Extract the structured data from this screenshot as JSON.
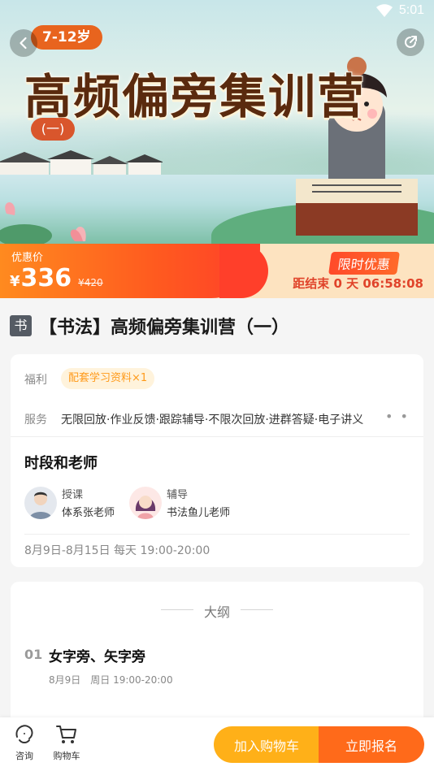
{
  "status_bar": {
    "time": "5:01"
  },
  "hero": {
    "age_tag": "7-12岁",
    "title": "高频偏旁集训营",
    "sub_tag": "(一)"
  },
  "price": {
    "label": "优惠价",
    "currency": "¥",
    "value": "336",
    "original": "¥420",
    "limited_tag": "限时优惠",
    "countdown": "距结束 0 天 06:58:08"
  },
  "course": {
    "badge": "书",
    "title": "【书法】高频偏旁集训营（一）"
  },
  "info": {
    "benefit_label": "福利",
    "benefit_pill": "配套学习资料×1",
    "service_label": "服务",
    "service_text": "无限回放·作业反馈·跟踪辅导·不限次回放·进群答疑·电子讲义",
    "section_title": "时段和老师",
    "teachers": [
      {
        "role": "授课",
        "name": "体系张老师"
      },
      {
        "role": "辅导",
        "name": "书法鱼儿老师"
      }
    ],
    "schedule": "8月9日-8月15日 每天 19:00-20:00"
  },
  "outline": {
    "heading": "大纲",
    "lessons": [
      {
        "num": "01",
        "title": "女字旁、矢字旁",
        "time": "8月9日　周日 19:00-20:00"
      }
    ]
  },
  "bottom_bar": {
    "consult_label": "咨询",
    "cart_label": "购物车",
    "add_cart": "加入购物车",
    "signup": "立即报名"
  },
  "colors": {
    "accent_orange": "#ff6a1a",
    "accent_yellow": "#ffb018",
    "countdown_red": "#e0432a"
  }
}
